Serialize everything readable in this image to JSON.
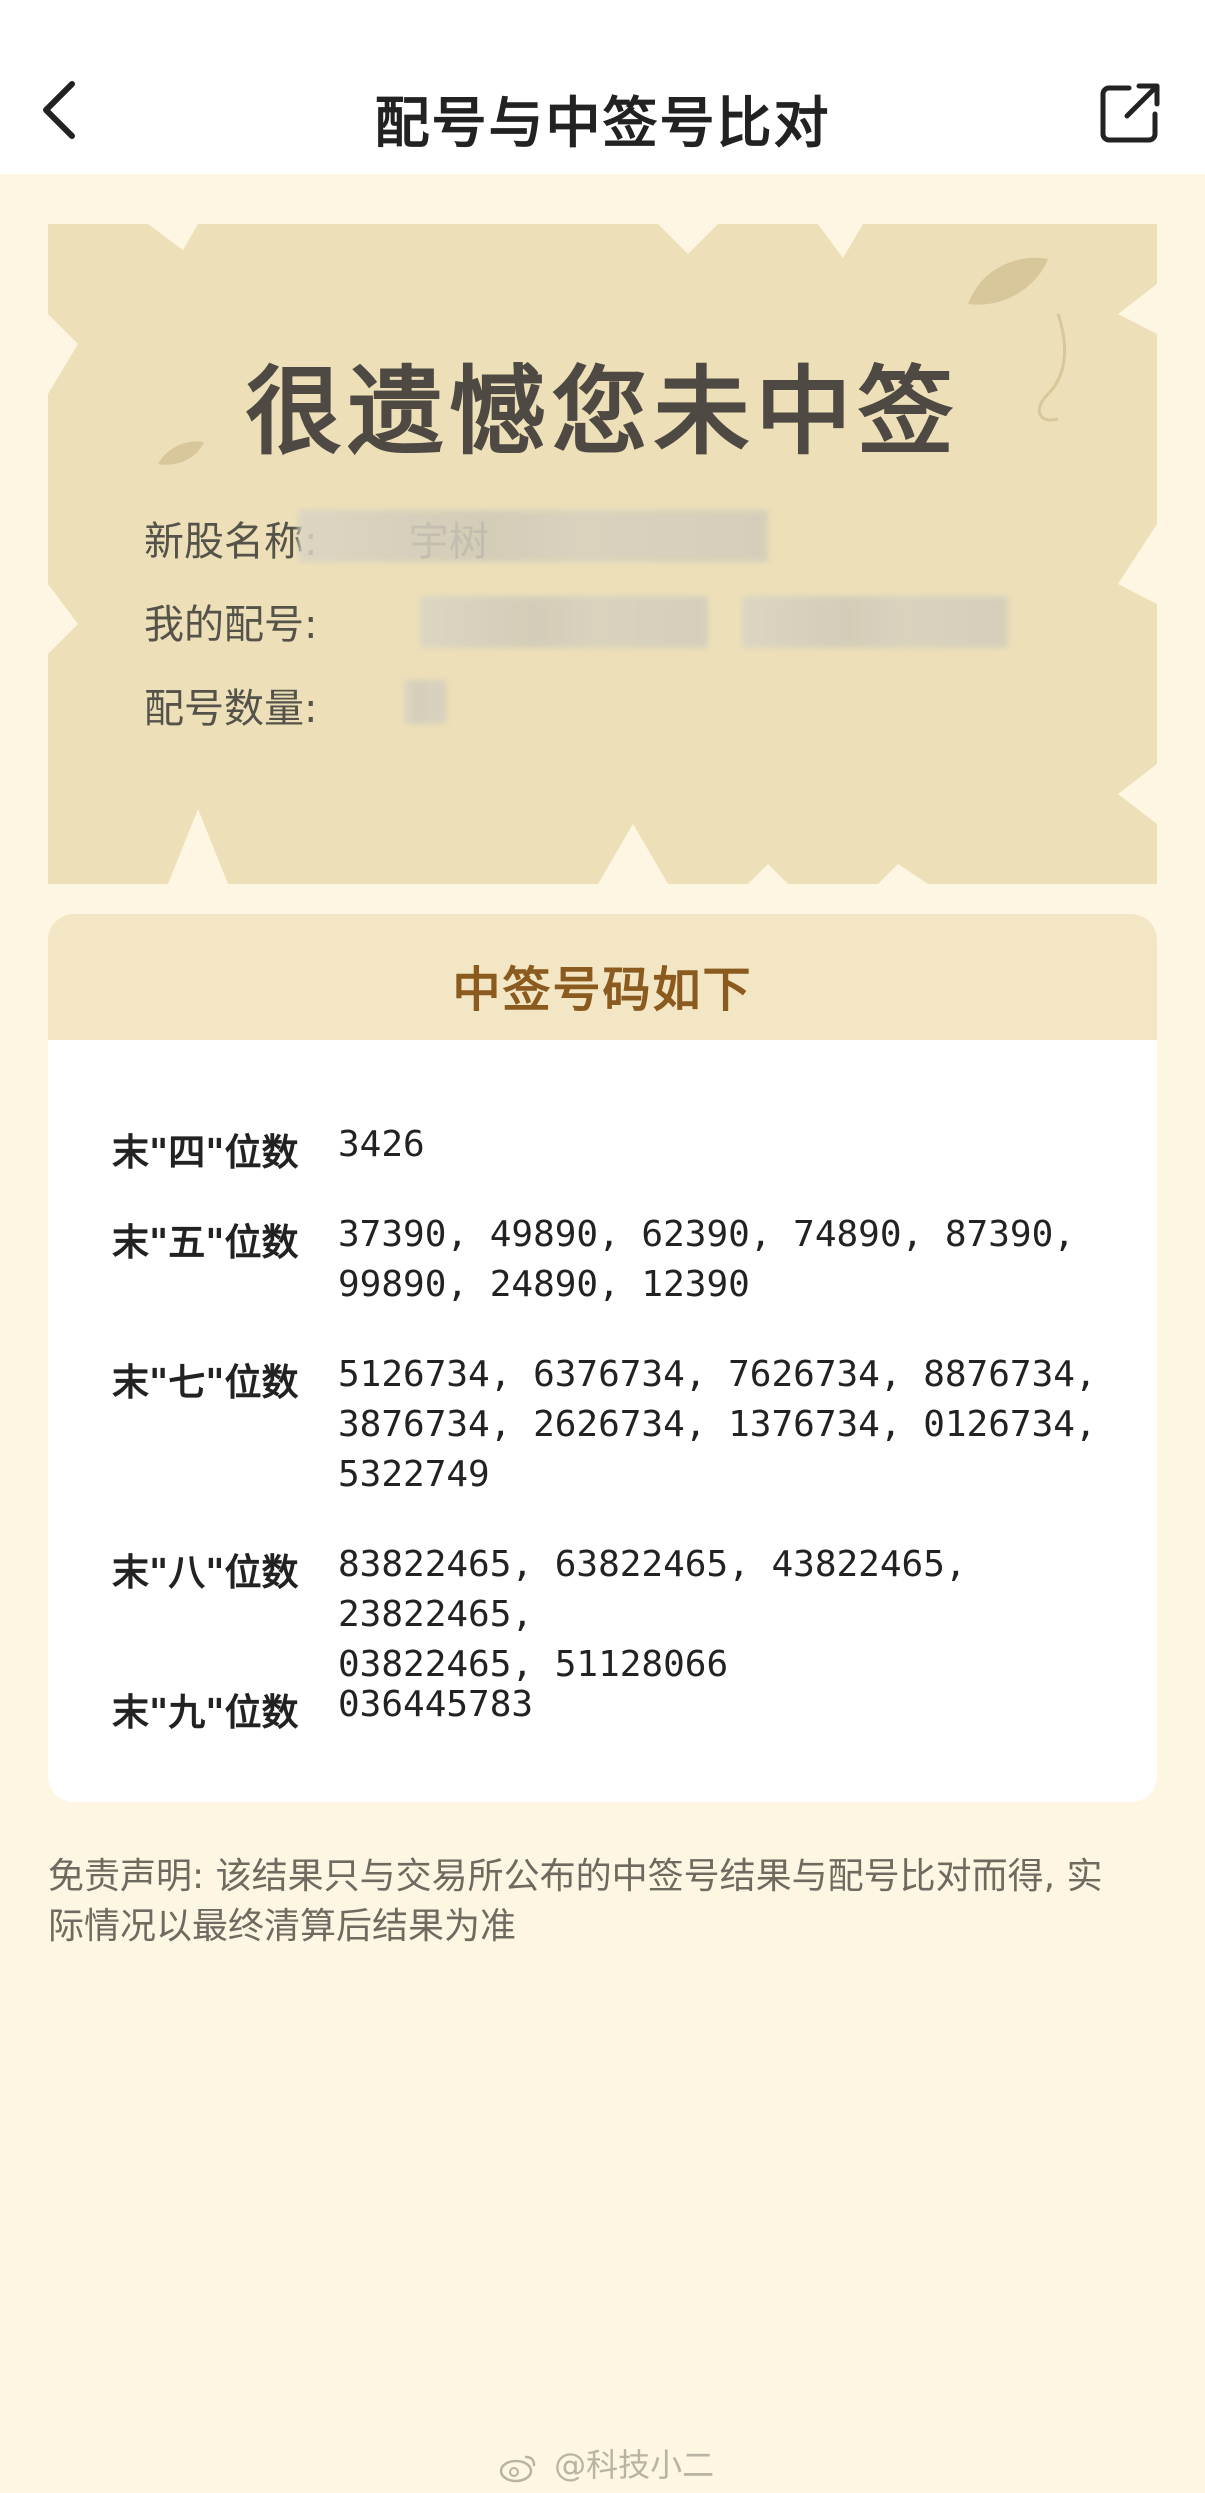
{
  "header": {
    "title": "配号与中签号比对",
    "back_icon": "chevron-left-icon",
    "share_icon": "share-external-icon"
  },
  "result": {
    "headline": "很遗憾您未中签",
    "rows": [
      {
        "label": "新股名称:",
        "value_partial": "宇树",
        "note": "blurred"
      },
      {
        "label": "我的配号:",
        "note": "blurred"
      },
      {
        "label": "配号数量:",
        "note": "blurred"
      }
    ]
  },
  "winning": {
    "title": "中签号码如下",
    "rows": [
      {
        "label": "末\"四\"位数",
        "value": "3426"
      },
      {
        "label": "末\"五\"位数",
        "lines": [
          "37390, 49890, 62390, 74890, 87390,",
          "99890, 24890, 12390"
        ]
      },
      {
        "label": "末\"七\"位数",
        "lines": [
          "5126734, 6376734, 7626734, 8876734,",
          "3876734, 2626734, 1376734, 0126734,",
          "5322749"
        ]
      },
      {
        "label": "末\"八\"位数",
        "lines": [
          "83822465, 63822465, 43822465, 23822465,",
          "03822465, 51128066"
        ]
      },
      {
        "label": "末\"九\"位数",
        "value": "036445783"
      }
    ]
  },
  "disclaimer": {
    "lines": [
      "免责声明: 该结果只与交易所公布的中签号结果与配号比对而得, 实",
      "际情况以最终清算后结果为准"
    ]
  },
  "watermark": {
    "text": "@科技小二",
    "icon": "weibo-icon"
  },
  "colors": {
    "page_bg": "#fdf6e3",
    "card_bg": "#ede0b8",
    "panel_head_bg": "#f3e6c4",
    "panel_title": "#8a5a1f",
    "headline": "#4e4a43"
  }
}
